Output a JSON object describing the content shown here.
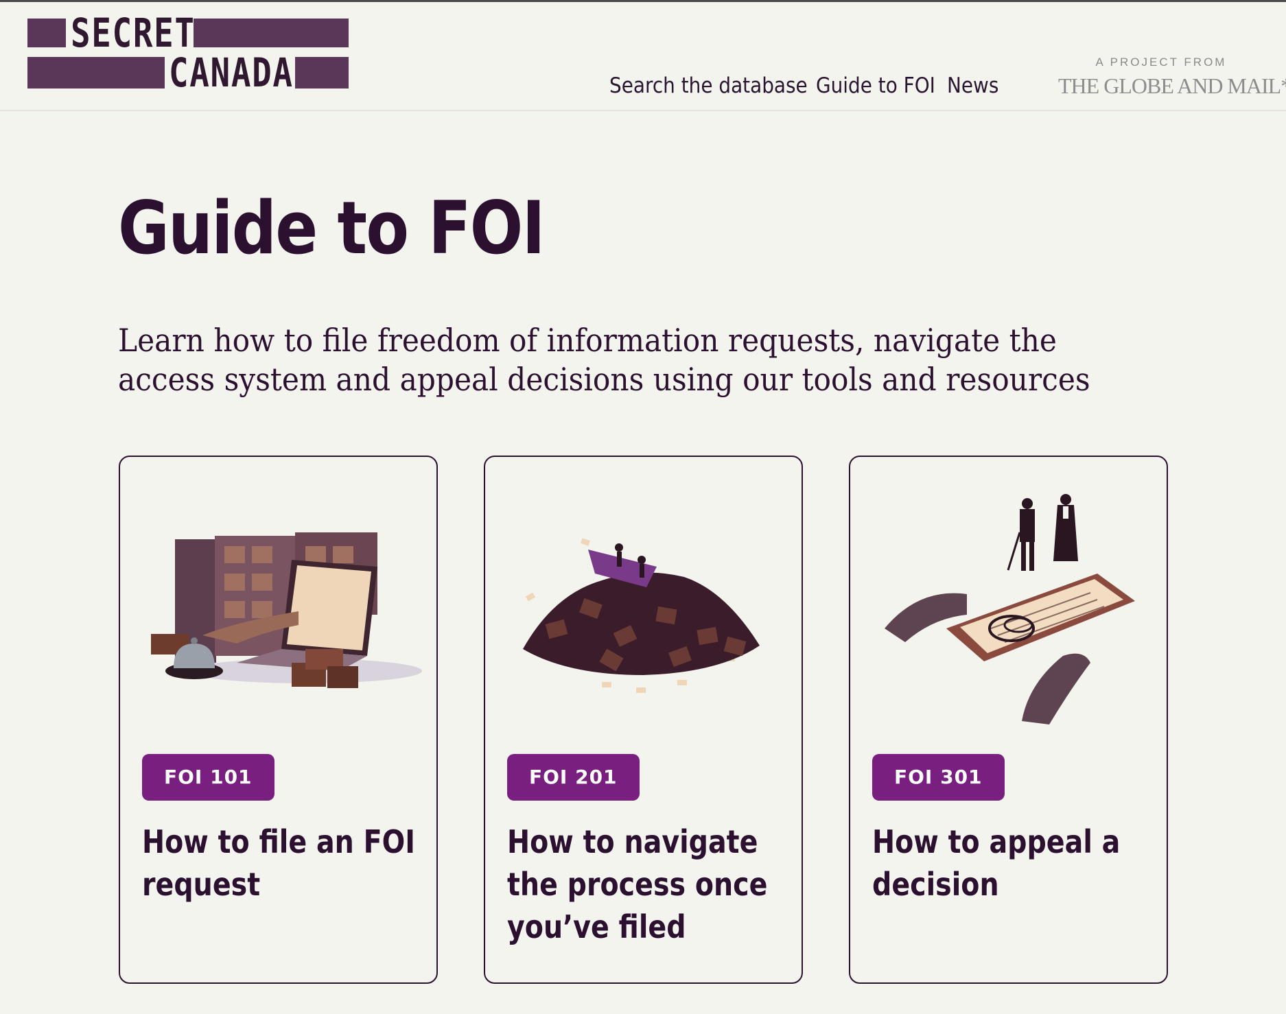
{
  "brand": {
    "logo_line1": "SECRET",
    "logo_line2": "CANADA",
    "color": "#5a3658"
  },
  "nav": {
    "items": [
      {
        "label": "Search the database"
      },
      {
        "label": "Guide to FOI"
      },
      {
        "label": "News"
      }
    ]
  },
  "partner": {
    "kicker": "A PROJECT FROM",
    "name": "THE GLOBE AND MAIL*"
  },
  "hero": {
    "title": "Guide to FOI",
    "intro_line1": "Learn how to file freedom of information requests, navigate the",
    "intro_line2": "access system and appeal decisions using our tools and resources"
  },
  "cards": [
    {
      "badge": "FOI 101",
      "title_lines": [
        "How to file an FOI",
        "request"
      ],
      "illustration": "laptop-filing-cabinet-illustration"
    },
    {
      "badge": "FOI 201",
      "title_lines": [
        "How to navigate",
        "the process once",
        "you’ve filed"
      ],
      "illustration": "box-pile-boat-illustration"
    },
    {
      "badge": "FOI 301",
      "title_lines": [
        "How to appeal a",
        "decision"
      ],
      "illustration": "hands-document-judge-illustration"
    }
  ],
  "colors": {
    "background": "#f4f4ef",
    "text": "#2b1030",
    "badge": "#781f80"
  }
}
